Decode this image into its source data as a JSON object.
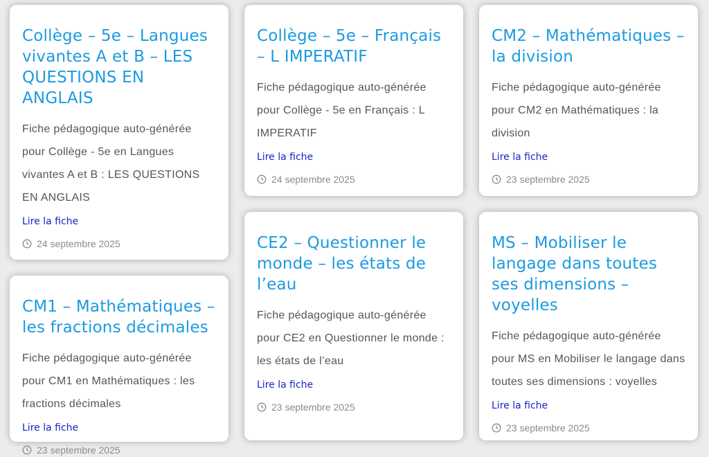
{
  "cards": [
    {
      "title": "Collège – 5e – Langues vivantes A et B – LES QUESTIONS EN ANGLAIS",
      "excerpt": "Fiche pédagogique auto-générée pour Collège - 5e en Langues vivantes A et B : LES QUESTIONS EN ANGLAIS",
      "link": "Lire la fiche",
      "date": "24 septembre 2025"
    },
    {
      "title": "Collège – 5e – Français – L IMPERATIF",
      "excerpt": "Fiche pédagogique auto-générée pour Collège - 5e en Français : L IMPERATIF",
      "link": "Lire la fiche",
      "date": "24 septembre 2025"
    },
    {
      "title": "CM2 – Mathématiques – la division",
      "excerpt": "Fiche pédagogique auto-générée pour CM2 en Mathématiques : la division",
      "link": "Lire la fiche",
      "date": "23 septembre 2025"
    },
    {
      "title": "CM1 – Mathématiques – les fractions décimales",
      "excerpt": "Fiche pédagogique auto-générée pour CM1 en Mathématiques : les fractions décimales",
      "link": "Lire la fiche",
      "date": "23 septembre 2025"
    },
    {
      "title": "CE2 – Questionner le monde – les états de l’eau",
      "excerpt": "Fiche pédagogique auto-générée pour CE2 en Questionner le monde : les états de l’eau",
      "link": "Lire la fiche",
      "date": "23 septembre 2025"
    },
    {
      "title": "MS – Mobiliser le langage dans toutes ses dimensions – voyelles",
      "excerpt": "Fiche pédagogique auto-générée pour MS en Mobiliser le langage dans toutes ses dimensions : voyelles",
      "link": "Lire la fiche",
      "date": "23 septembre 2025"
    }
  ],
  "icons": {
    "date": "clock-icon"
  },
  "colors": {
    "title": "#1b9ae0",
    "link": "#1a22c7",
    "text": "#555555",
    "meta": "#8a8a8a",
    "background": "#ececec"
  }
}
